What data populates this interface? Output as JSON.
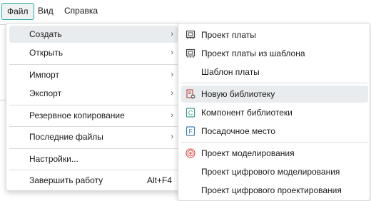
{
  "menubar": {
    "file": "Файл",
    "view": "Вид",
    "help": "Справка"
  },
  "file_menu": {
    "create": "Создать",
    "open": "Открыть",
    "import": "Импорт",
    "export": "Экспорт",
    "backup": "Резервное копирование",
    "recent": "Последние файлы",
    "settings": "Настройки...",
    "quit": "Завершить работу",
    "quit_shortcut": "Alt+F4",
    "submenu_arrow": "›"
  },
  "create_submenu": {
    "board_project": "Проект платы",
    "board_project_from_template": "Проект платы из шаблона",
    "board_template": "Шаблон платы",
    "new_library": "Новую библиотеку",
    "library_component": "Компонент библиотеки",
    "footprint": "Посадочное место",
    "simulation_project": "Проект моделирования",
    "digital_simulation_project": "Проект цифрового моделирования",
    "digital_design_project": "Проект цифрового проектирования"
  },
  "colors": {
    "accent": "#2aa7a4",
    "hover": "#e9ecee",
    "library_icon": "#c0504d",
    "simulation_icon": "#d9534f",
    "component_icon": "#3a9a8a"
  },
  "icons": {
    "board_project": "pcb-board-icon",
    "board_project_from_template": "pcb-board-template-icon",
    "new_library": "new-library-icon",
    "library_component": "component-icon",
    "footprint": "footprint-icon",
    "simulation_project": "simulation-icon"
  }
}
